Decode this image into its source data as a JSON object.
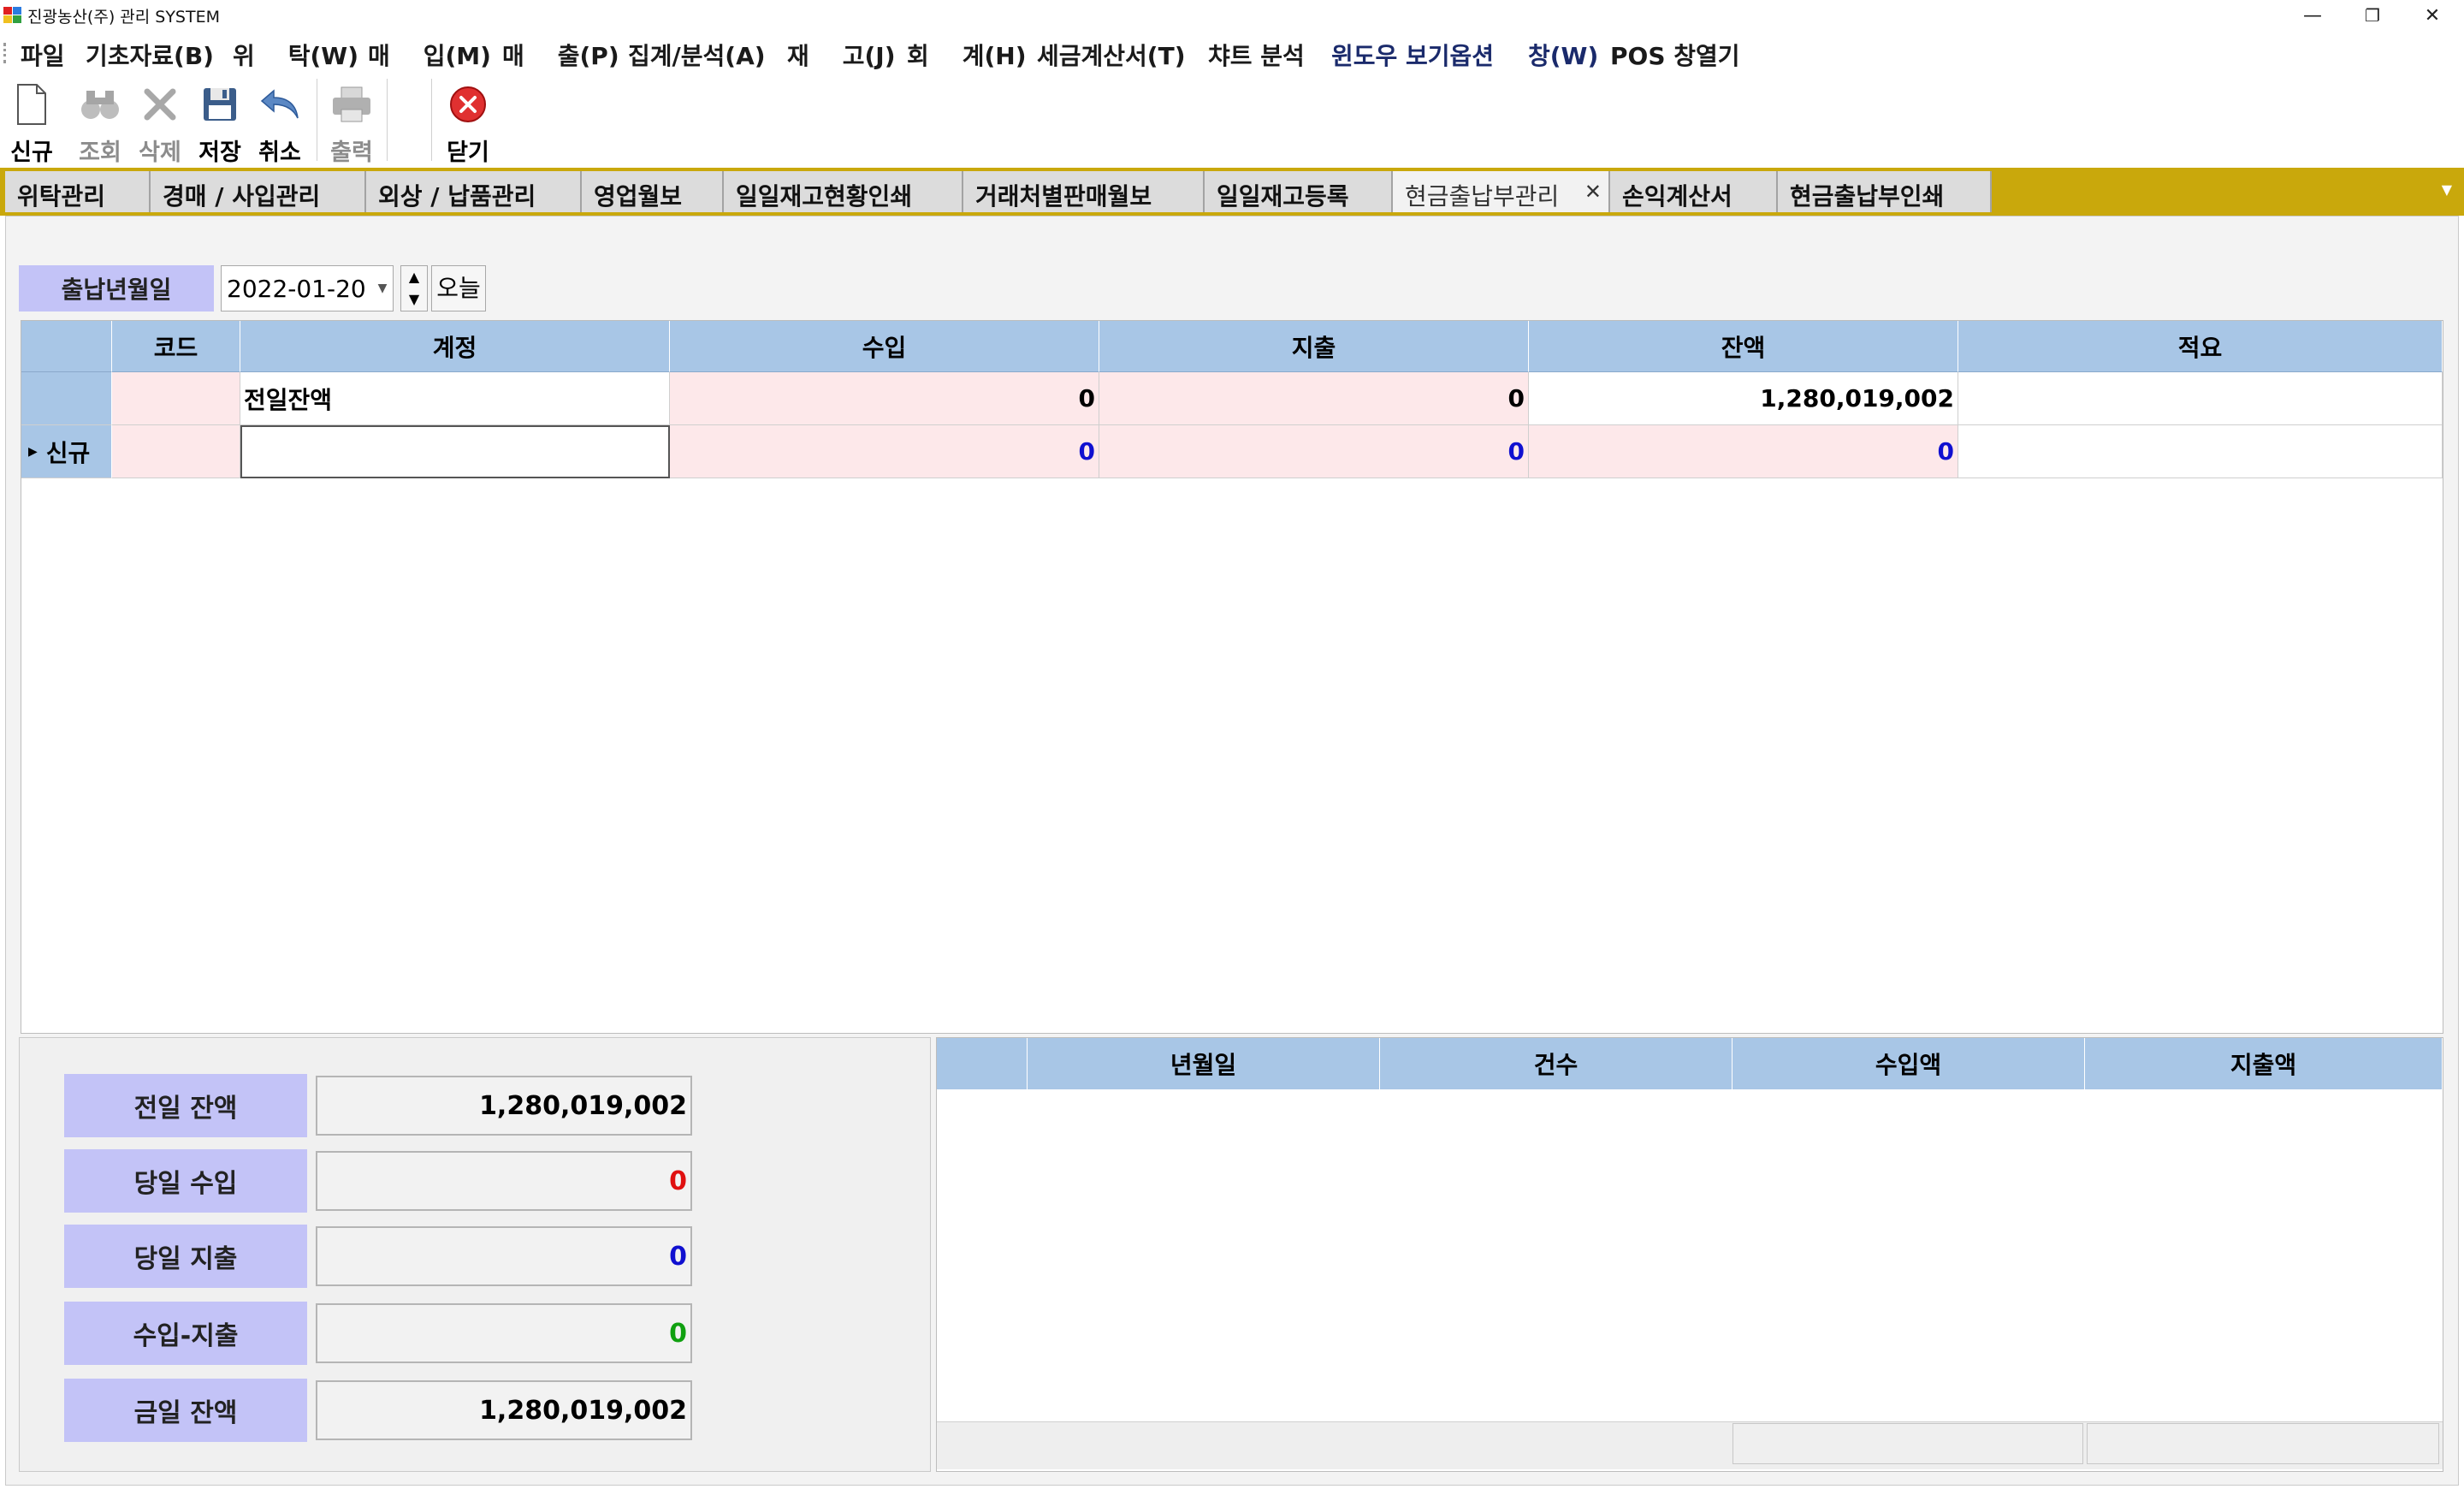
{
  "window": {
    "title": "진광농산(주) 관리 SYSTEM",
    "minimize": "—",
    "restore": "❐",
    "close": "✕"
  },
  "menu": [
    "파일",
    "기초자료(B)",
    "위    탁(W)",
    "매    입(M)",
    "매    출(P)",
    "집계/분석(A)",
    "재    고(J)",
    "회    계(H)",
    "세금계산서(T)",
    "챠트 분석",
    "윈도우 보기옵션",
    "창(W)",
    "POS 창열기"
  ],
  "toolbar": {
    "new": "신규",
    "search": "조회",
    "delete": "삭제",
    "save": "저장",
    "cancel": "취소",
    "print": "출력",
    "close": "닫기"
  },
  "tabs": [
    "위탁관리",
    "경매 / 사입관리",
    "외상 / 납품관리",
    "영업월보",
    "일일재고현황인쇄",
    "거래처별판매월보",
    "일일재고등록",
    "현금출납부관리",
    "손익계산서",
    "현금출납부인쇄"
  ],
  "active_tab_index": 7,
  "filter": {
    "date_label": "출납년월일",
    "date_value": "2022-01-20",
    "today_button": "오늘"
  },
  "grid": {
    "columns": [
      "코드",
      "계정",
      "수입",
      "지출",
      "잔액",
      "적요"
    ],
    "rows": [
      {
        "row_header": "",
        "code": "",
        "account": "전일잔액",
        "income": "0",
        "expense": "0",
        "balance": "1,280,019,002",
        "memo": ""
      },
      {
        "row_header": "신규",
        "code": "",
        "account": "",
        "income": "0",
        "expense": "0",
        "balance": "0",
        "memo": ""
      }
    ]
  },
  "summary": {
    "prev_balance_label": "전일 잔액",
    "prev_balance": "1,280,019,002",
    "today_income_label": "당일 수입",
    "today_income": "0",
    "today_expense_label": "당일 지출",
    "today_expense": "0",
    "net_label": "수입-지출",
    "net": "0",
    "current_balance_label": "금일 잔액",
    "current_balance": "1,280,019,002",
    "colors": {
      "income": "#e01010",
      "expense": "#1010d0",
      "net": "#10a010"
    }
  },
  "daily_grid": {
    "columns": [
      "년월일",
      "건수",
      "수입액",
      "지출액"
    ]
  },
  "colors": {
    "tab_strip": "#c9a80c",
    "grid_header": "#a8c6e6",
    "label_purple": "#c3c3f7",
    "row_pink": "#fde8ea"
  }
}
